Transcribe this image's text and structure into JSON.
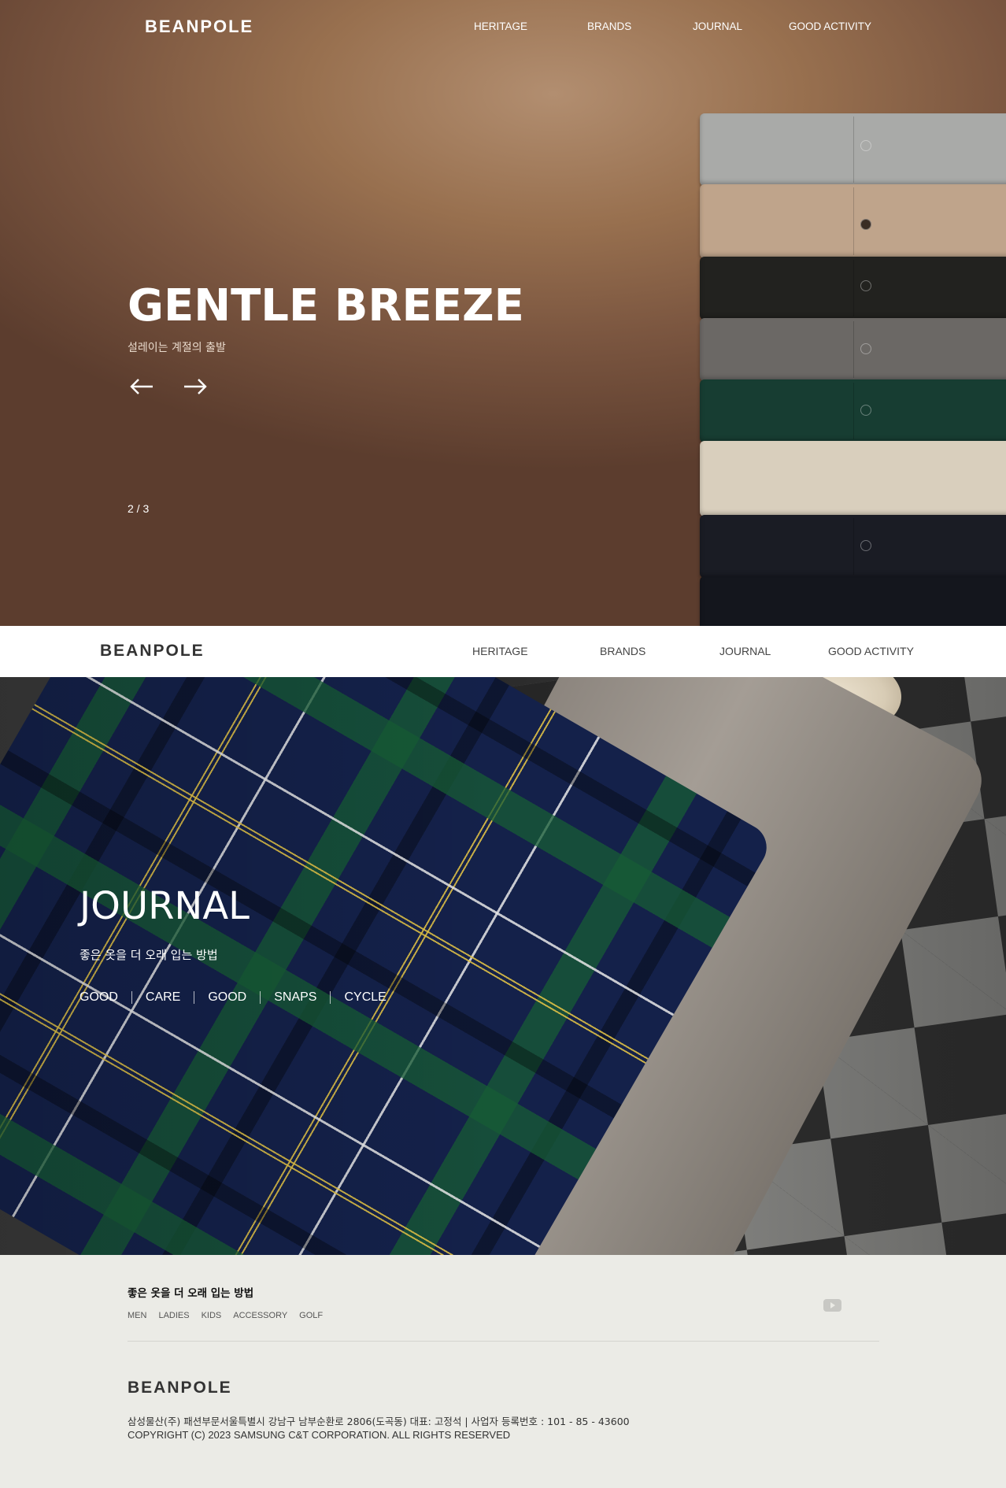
{
  "brand": "BEANPOLE",
  "nav": [
    "HERITAGE",
    "BRANDS",
    "JOURNAL",
    "GOOD ACTIVITY"
  ],
  "hero": {
    "title": "GENTLE BREEZE",
    "subtitle": "설레이는 계절의 출발",
    "counter": "2 / 3",
    "prev_icon": "arrow-left-icon",
    "next_icon": "arrow-right-icon",
    "sweater_colors": [
      "#a9aaa8",
      "#bfa48b",
      "#22221f",
      "#6b6865",
      "#173d32",
      "#d9cfbd",
      "#1a1c24",
      "#14161d"
    ]
  },
  "journal": {
    "title": "JOURNAL",
    "subtitle": "좋은 옷을 더 오래 입는 방법",
    "tags": [
      "GOOD",
      "CARE",
      "GOOD",
      "SNAPS",
      "CYCLE"
    ]
  },
  "footer": {
    "heading": "좋은 옷을 더 오래 입는 방법",
    "links": [
      "MEN",
      "LADIES",
      "KIDS",
      "ACCESSORY",
      "GOLF"
    ],
    "social_icon": "youtube-icon",
    "logo": "BEANPOLE",
    "address": "삼성물산(주) 패션부문서울특별시 강남구 남부순환로 2806(도곡동) 대표: 고정석 | 사업자 등록번호 : 101 - 85 - 43600",
    "copyright": "COPYRIGHT (C) 2023 SAMSUNG C&T CORPORATION. ALL RIGHTS RESERVED"
  }
}
